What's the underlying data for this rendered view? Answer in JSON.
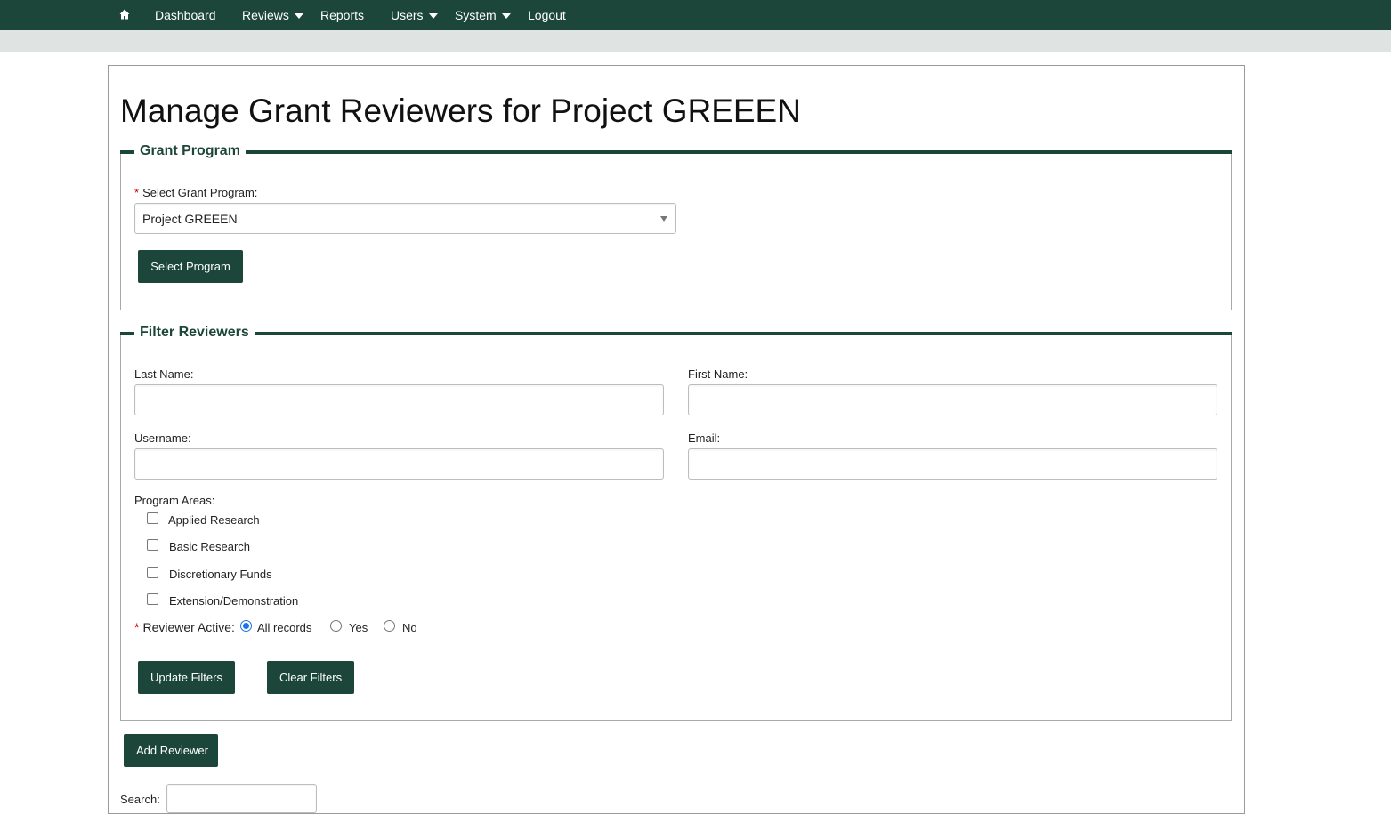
{
  "nav": {
    "items": [
      {
        "label": "Dashboard",
        "dropdown": false
      },
      {
        "label": "Reviews",
        "dropdown": true
      },
      {
        "label": "Reports",
        "dropdown": false
      },
      {
        "label": "Users",
        "dropdown": true
      },
      {
        "label": "System",
        "dropdown": true
      },
      {
        "label": "Logout",
        "dropdown": false
      }
    ],
    "home_icon": "home-icon",
    "colors": {
      "bar": "#1b4639",
      "text": "#ffffff"
    }
  },
  "page": {
    "title": "Manage Grant Reviewers for Project GREEEN"
  },
  "grant_program": {
    "legend": "Grant Program",
    "select_label": "Select Grant Program:",
    "required_mark": "*",
    "selected_value": "Project GREEEN",
    "select_button": "Select Program"
  },
  "filters": {
    "legend": "Filter Reviewers",
    "last_name_label": "Last Name:",
    "last_name_value": "",
    "first_name_label": "First Name:",
    "first_name_value": "",
    "username_label": "Username:",
    "username_value": "",
    "email_label": "Email:",
    "email_value": "",
    "program_areas_label": "Program Areas:",
    "program_areas": [
      {
        "label": "Applied Research",
        "checked": false
      },
      {
        "label": "Basic Research",
        "checked": false
      },
      {
        "label": "Discretionary Funds",
        "checked": false
      },
      {
        "label": "Extension/Demonstration",
        "checked": false
      }
    ],
    "active_required_mark": "*",
    "active_label": "Reviewer Active:",
    "active_options": [
      {
        "label": "All records",
        "checked": true
      },
      {
        "label": "Yes",
        "checked": false
      },
      {
        "label": "No",
        "checked": false
      }
    ],
    "update_button": "Update Filters",
    "clear_button": "Clear Filters"
  },
  "actions": {
    "add_button": "Add Reviewer",
    "search_label": "Search:",
    "search_value": ""
  },
  "colors": {
    "accent": "#1b4639",
    "required": "#cc0000",
    "radio_selected": "#1a73e8"
  }
}
